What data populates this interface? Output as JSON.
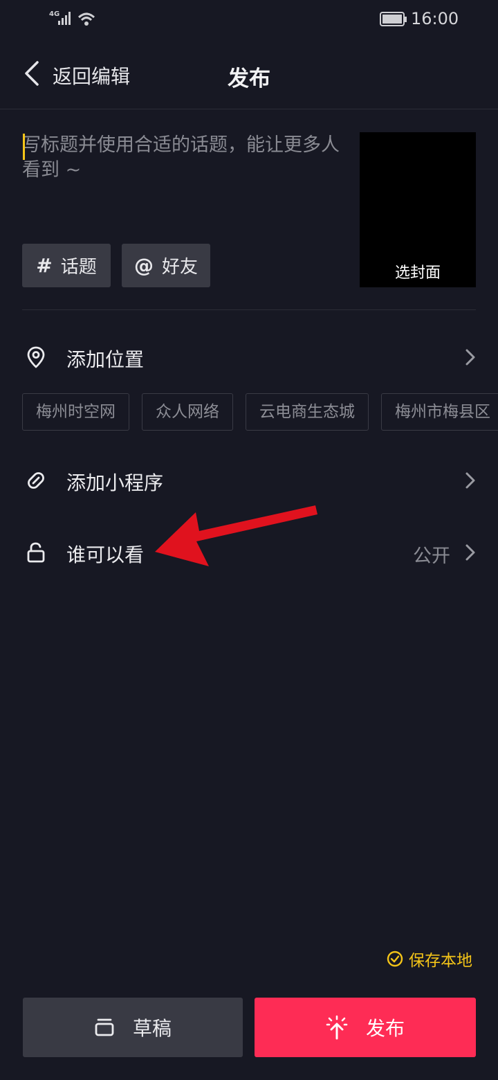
{
  "status_bar": {
    "network": "4G",
    "time": "16:00",
    "icons": [
      "signal-icon",
      "wifi-icon",
      "battery-icon"
    ]
  },
  "header": {
    "back_label": "返回编辑",
    "title": "发布"
  },
  "post": {
    "title_placeholder": "写标题并使用合适的话题，能让更多人看到 ~",
    "cover_label": "选封面",
    "topic_chip": {
      "symbol": "#",
      "label": "话题"
    },
    "friend_chip": {
      "symbol": "@",
      "label": "好友"
    }
  },
  "options": {
    "location": {
      "label": "添加位置",
      "icon": "location-pin-icon"
    },
    "location_tags": [
      "梅州时空网",
      "众人网络",
      "云电商生态城",
      "梅州市梅县区"
    ],
    "mini_program": {
      "label": "添加小程序",
      "icon": "link-icon"
    },
    "visibility": {
      "label": "谁可以看",
      "value": "公开",
      "icon": "lock-open-icon"
    }
  },
  "save_local": {
    "label": "保存本地",
    "checked": true
  },
  "buttons": {
    "draft": "草稿",
    "publish": "发布"
  },
  "colors": {
    "background": "#171823",
    "accent_publish": "#fe2c55",
    "accent_yellow": "#f5c518",
    "annotation_arrow": "#e0121e"
  }
}
